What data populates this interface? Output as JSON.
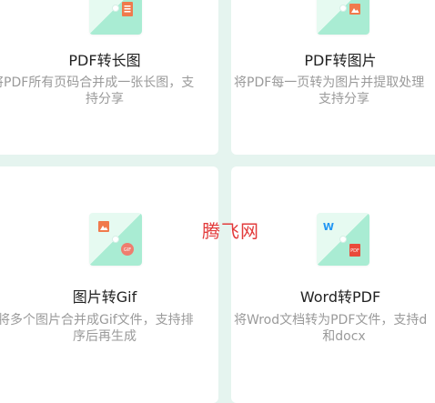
{
  "features": [
    {
      "title": "PDF转长图",
      "desc_line1": "将PDF所有页码合并成一张长图，支",
      "desc_line2": "持分享",
      "icon": "pdf-to-long-image-icon"
    },
    {
      "title": "PDF转图片",
      "desc_line1": "将PDF每一页转为图片并提取处理",
      "desc_line2": "支持分享",
      "icon": "pdf-to-image-icon"
    },
    {
      "title": "图片转Gif",
      "desc_line1": "将多个图片合并成Gif文件，支持排",
      "desc_line2": "序后再生成",
      "icon": "image-to-gif-icon"
    },
    {
      "title": "Word转PDF",
      "desc_line1": "将Wrod文档转为PDF文件，支持d",
      "desc_line2": "和docx",
      "icon": "word-to-pdf-icon"
    }
  ],
  "watermark": "腾飞网",
  "colors": {
    "background": "#e5f4ef",
    "tile_light": "#e6faf1",
    "tile_accent": "#a9ecd3",
    "icon_orange": "#f07a4c",
    "icon_red": "#e94a3b",
    "word_blue": "#2196f3"
  }
}
